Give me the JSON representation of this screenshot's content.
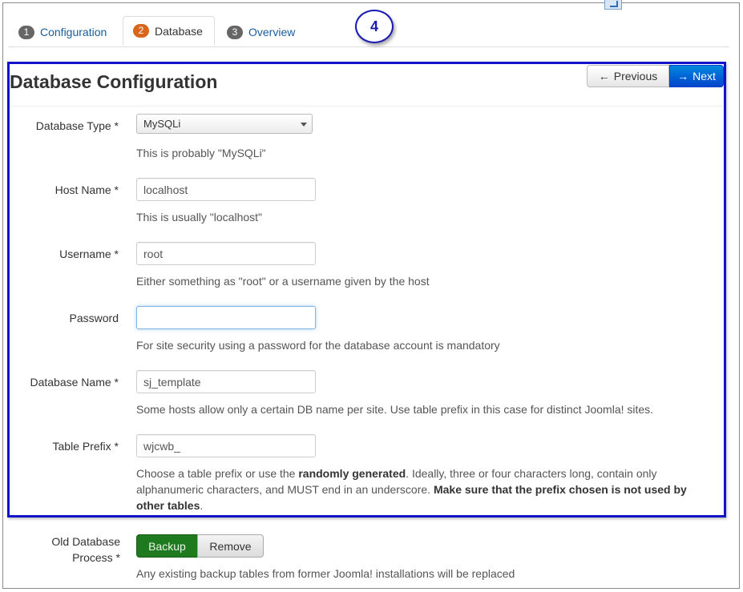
{
  "tabs": [
    {
      "number": "1",
      "label": "Configuration",
      "active": false
    },
    {
      "number": "2",
      "label": "Database",
      "active": true
    },
    {
      "number": "3",
      "label": "Overview",
      "active": false
    }
  ],
  "step_callout": "4",
  "panel": {
    "title": "Database Configuration",
    "previous_label": "Previous",
    "next_label": "Next"
  },
  "fields": {
    "db_type": {
      "label": "Database Type *",
      "value": "MySQLi",
      "help": "This is probably \"MySQLi\""
    },
    "host": {
      "label": "Host Name *",
      "value": "localhost",
      "help": "This is usually \"localhost\""
    },
    "username": {
      "label": "Username *",
      "value": "root",
      "help": "Either something as \"root\" or a username given by the host"
    },
    "password": {
      "label": "Password",
      "value": "",
      "help": "For site security using a password for the database account is mandatory"
    },
    "db_name": {
      "label": "Database Name *",
      "value": "sj_template",
      "help": "Some hosts allow only a certain DB name per site. Use table prefix in this case for distinct Joomla! sites."
    },
    "prefix": {
      "label": "Table Prefix *",
      "value": "wjcwb_",
      "help_parts": {
        "p1": "Choose a table prefix or use the ",
        "b1": "randomly generated",
        "p2": ". Ideally, three or four characters long, contain only alphanumeric characters, and MUST end in an underscore. ",
        "b2": "Make sure that the prefix chosen is not used by other tables",
        "p3": "."
      }
    }
  },
  "old_db": {
    "label": "Old Database Process *",
    "backup_label": "Backup",
    "remove_label": "Remove",
    "help": "Any existing backup tables from former Joomla! installations will be replaced"
  },
  "colors": {
    "callout_border": "#1a1ab5",
    "panel_border": "#1212c8",
    "next_button": "#0044cc",
    "backup_button": "#1e7a1e",
    "active_badge": "#d9661b",
    "link": "#1a5c9a"
  }
}
